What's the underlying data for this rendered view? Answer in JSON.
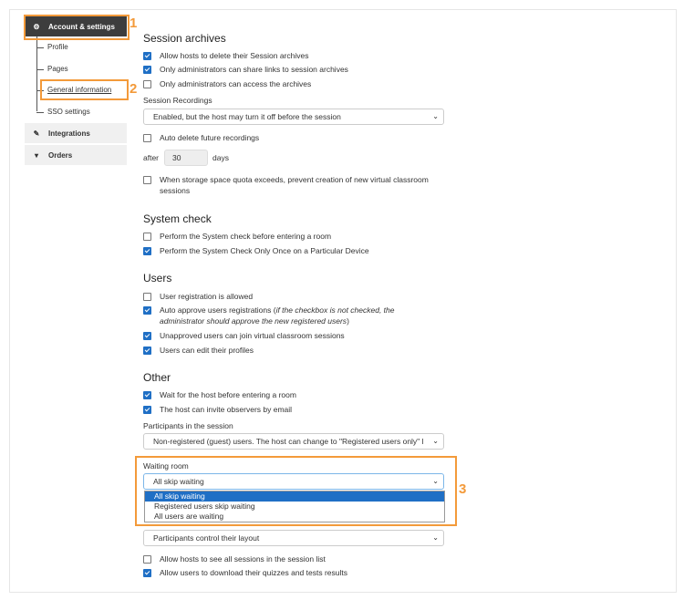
{
  "sidebar": {
    "account_label": "Account & settings",
    "sub_items": [
      "Profile",
      "Pages",
      "General information",
      "SSO settings"
    ],
    "integrations_label": "Integrations",
    "orders_label": "Orders"
  },
  "callouts": [
    "1",
    "2",
    "3"
  ],
  "archives": {
    "title": "Session archives",
    "cb1": "Allow hosts to delete their Session archives",
    "cb2": "Only administrators can share links to session archives",
    "cb3": "Only administrators can access the archives",
    "recordings_label": "Session Recordings",
    "recordings_value": "Enabled, but the host may turn it off before the session",
    "auto_delete": "Auto delete future recordings",
    "after": "after",
    "days_value": "30",
    "days": "days",
    "quota_line1": "When storage space quota exceeds, prevent creation of new virtual classroom",
    "quota_line2": "sessions"
  },
  "system_check": {
    "title": "System check",
    "cb1": "Perform the System check before entering a room",
    "cb2": "Perform the System Check Only Once on a Particular Device"
  },
  "users": {
    "title": "Users",
    "cb1": "User registration is allowed",
    "cb2_main": "Auto approve users registrations (",
    "cb2_italic": "if the checkbox is not checked, the",
    "cb2_line2_italic": "administrator should approve the new registered users",
    "cb2_close": ")",
    "cb3": "Unapproved users can join virtual classroom sessions",
    "cb4": "Users can edit their profiles"
  },
  "other": {
    "title": "Other",
    "cb1": "Wait for the host before entering a room",
    "cb2": "The host can invite observers by email",
    "participants_label": "Participants in the session",
    "participants_value": "Non-registered (guest) users. The host can change to \"Registered users only\" l",
    "waiting_label": "Waiting room",
    "waiting_value": "All skip waiting",
    "waiting_options": [
      "All skip waiting",
      "Registered users skip waiting",
      "All users are waiting"
    ],
    "layout_value": "Participants control their layout",
    "cb3": "Allow hosts to see all sessions in the session list",
    "cb4": "Allow users to download their quizzes and tests results"
  },
  "colors": {
    "accent": "#f39a3a",
    "checkbox": "#1f6fc5",
    "sidebar_active": "#3d3d3d"
  }
}
